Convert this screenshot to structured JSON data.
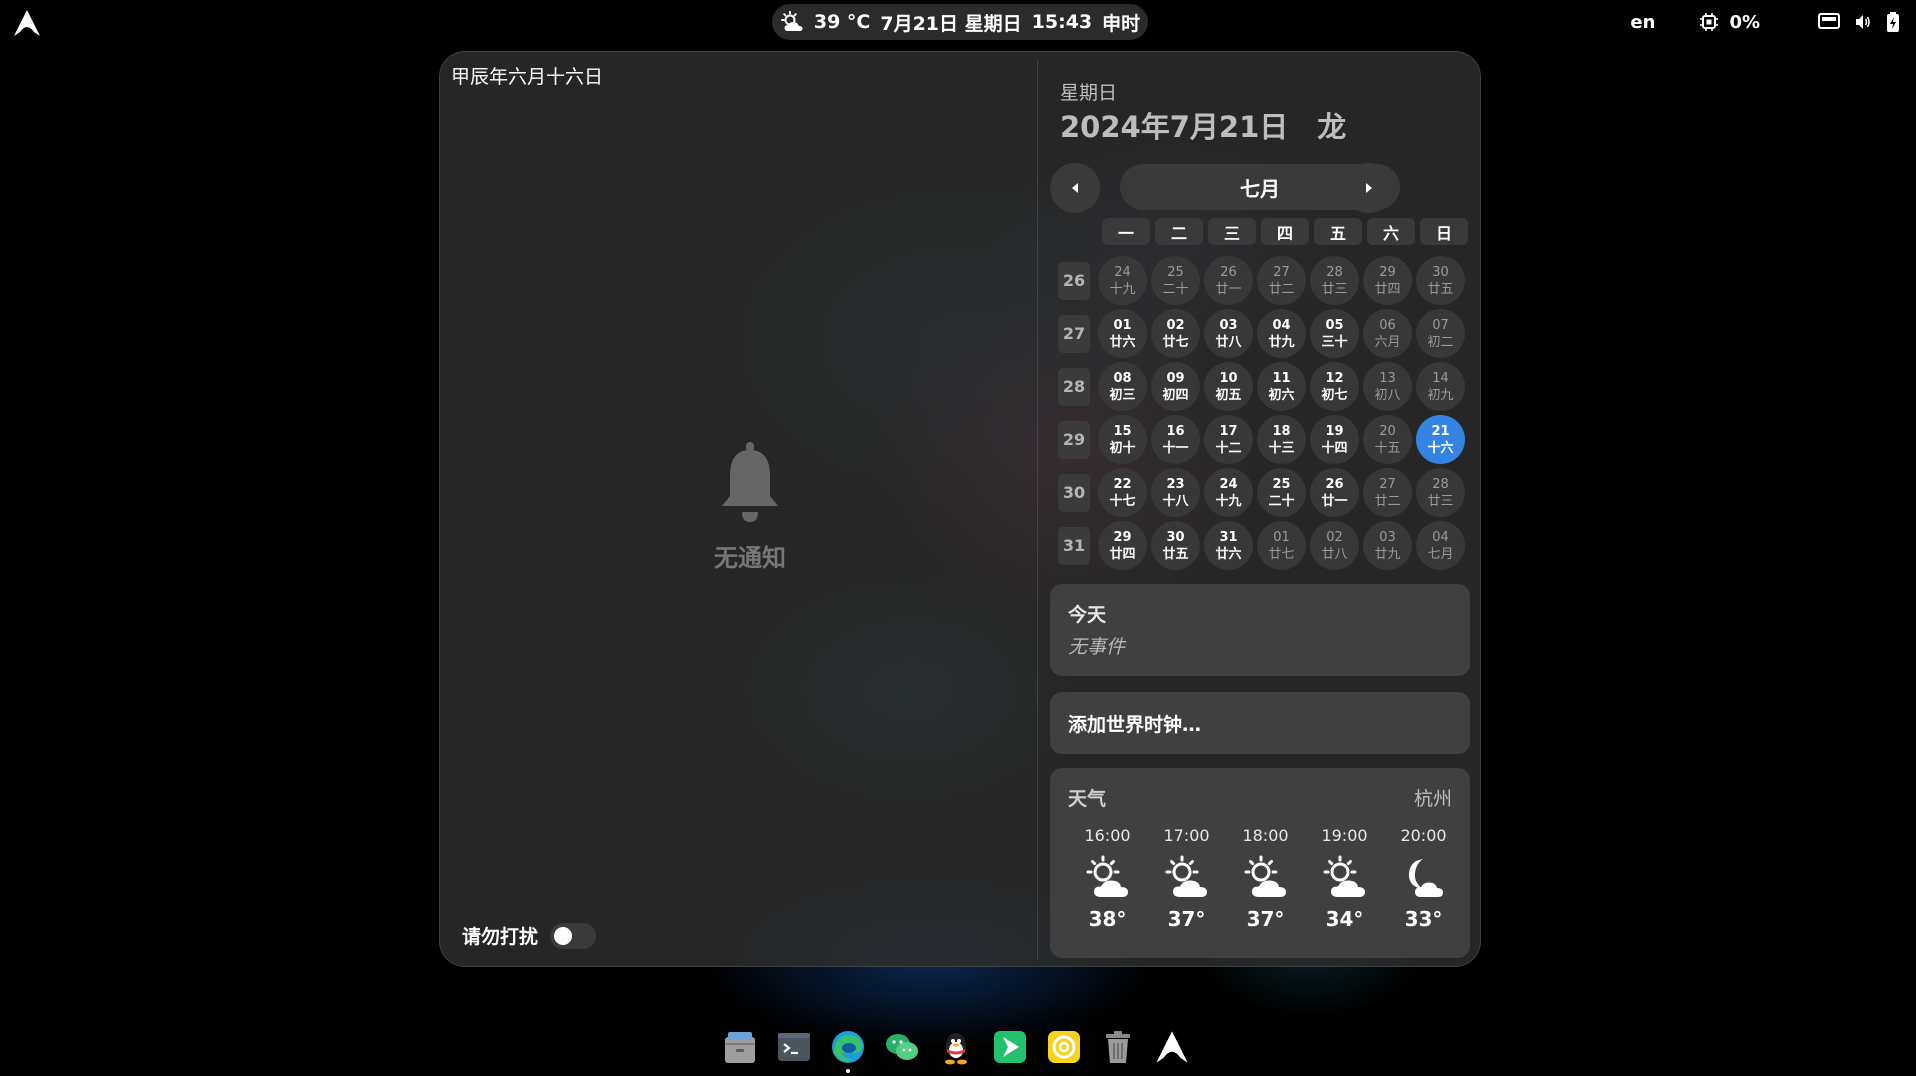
{
  "topbar": {
    "activities_icon": "arch-linux-logo-icon",
    "weather_icon": "partly-cloudy-day-icon",
    "temperature": "39 °C",
    "date": "7月21日 星期日",
    "time": "15:43",
    "shichen": "申时",
    "keyboard_layout": "en",
    "cpu_icon": "cpu-icon",
    "cpu_usage": "0%",
    "network_icon": "network-wired-icon",
    "volume_icon": "speaker-icon",
    "battery_icon": "battery-charging-icon"
  },
  "notifications": {
    "lunar_date_heading": "甲辰年六月十六日",
    "empty_icon": "bell-icon",
    "empty_label": "无通知",
    "dnd_label": "请勿打扰",
    "dnd_enabled": false
  },
  "calendar": {
    "weekday": "星期日",
    "full_date": "2024年7月21日　龙",
    "month_label": "七月",
    "prev_icon": "chevron-left-icon",
    "next_icon": "chevron-right-icon",
    "weekday_headers": [
      "一",
      "二",
      "三",
      "四",
      "五",
      "六",
      "日"
    ],
    "weeks": [
      {
        "week": "26",
        "days": [
          {
            "d": "24",
            "l": "十九",
            "other": true
          },
          {
            "d": "25",
            "l": "二十",
            "other": true
          },
          {
            "d": "26",
            "l": "廿一",
            "other": true
          },
          {
            "d": "27",
            "l": "廿二",
            "other": true
          },
          {
            "d": "28",
            "l": "廿三",
            "other": true
          },
          {
            "d": "29",
            "l": "廿四",
            "other": true
          },
          {
            "d": "30",
            "l": "廿五",
            "other": true
          }
        ]
      },
      {
        "week": "27",
        "days": [
          {
            "d": "01",
            "l": "廿六"
          },
          {
            "d": "02",
            "l": "廿七"
          },
          {
            "d": "03",
            "l": "廿八"
          },
          {
            "d": "04",
            "l": "廿九"
          },
          {
            "d": "05",
            "l": "三十"
          },
          {
            "d": "06",
            "l": "六月",
            "other": true
          },
          {
            "d": "07",
            "l": "初二",
            "other": true
          }
        ]
      },
      {
        "week": "28",
        "days": [
          {
            "d": "08",
            "l": "初三"
          },
          {
            "d": "09",
            "l": "初四"
          },
          {
            "d": "10",
            "l": "初五"
          },
          {
            "d": "11",
            "l": "初六"
          },
          {
            "d": "12",
            "l": "初七"
          },
          {
            "d": "13",
            "l": "初八",
            "other": true
          },
          {
            "d": "14",
            "l": "初九",
            "other": true
          }
        ]
      },
      {
        "week": "29",
        "days": [
          {
            "d": "15",
            "l": "初十"
          },
          {
            "d": "16",
            "l": "十一"
          },
          {
            "d": "17",
            "l": "十二"
          },
          {
            "d": "18",
            "l": "十三"
          },
          {
            "d": "19",
            "l": "十四"
          },
          {
            "d": "20",
            "l": "十五",
            "other": true
          },
          {
            "d": "21",
            "l": "十六",
            "today": true
          }
        ]
      },
      {
        "week": "30",
        "days": [
          {
            "d": "22",
            "l": "十七"
          },
          {
            "d": "23",
            "l": "十八"
          },
          {
            "d": "24",
            "l": "十九"
          },
          {
            "d": "25",
            "l": "二十"
          },
          {
            "d": "26",
            "l": "廿一"
          },
          {
            "d": "27",
            "l": "廿二",
            "other": true
          },
          {
            "d": "28",
            "l": "廿三",
            "other": true
          }
        ]
      },
      {
        "week": "31",
        "days": [
          {
            "d": "29",
            "l": "廿四"
          },
          {
            "d": "30",
            "l": "廿五"
          },
          {
            "d": "31",
            "l": "廿六"
          },
          {
            "d": "01",
            "l": "廿七",
            "other": true
          },
          {
            "d": "02",
            "l": "廿八",
            "other": true
          },
          {
            "d": "03",
            "l": "廿九",
            "other": true
          },
          {
            "d": "04",
            "l": "七月",
            "other": true
          }
        ]
      }
    ]
  },
  "events": {
    "title": "今天",
    "empty_text": "无事件"
  },
  "world_clocks": {
    "add_label": "添加世界时钟…"
  },
  "weather": {
    "title": "天气",
    "city": "杭州",
    "forecast": [
      {
        "time": "16:00",
        "icon": "partly-cloudy-day-icon",
        "temp": "38°"
      },
      {
        "time": "17:00",
        "icon": "partly-cloudy-day-icon",
        "temp": "37°"
      },
      {
        "time": "18:00",
        "icon": "partly-cloudy-day-icon",
        "temp": "37°"
      },
      {
        "time": "19:00",
        "icon": "partly-cloudy-day-icon",
        "temp": "34°"
      },
      {
        "time": "20:00",
        "icon": "night-cloudy-icon",
        "temp": "33°"
      }
    ]
  },
  "dock": {
    "items": [
      {
        "name": "files",
        "icon": "file-cabinet-icon",
        "color": "#c9c9c9",
        "running": false
      },
      {
        "name": "terminal",
        "icon": "terminal-icon",
        "color": "#4a5560",
        "running": false
      },
      {
        "name": "edge",
        "icon": "edge-browser-icon",
        "color": "#1f9be0",
        "running": true
      },
      {
        "name": "wechat",
        "icon": "wechat-icon",
        "color": "#2aae67",
        "running": false
      },
      {
        "name": "qq",
        "icon": "qq-penguin-icon",
        "color": "#222222",
        "running": false
      },
      {
        "name": "app-store",
        "icon": "play-store-icon",
        "color": "#23c06d",
        "running": false
      },
      {
        "name": "netease-music",
        "icon": "music-disc-icon",
        "color": "#f7d21f",
        "running": false
      },
      {
        "name": "trash",
        "icon": "trash-icon",
        "color": "#9a9a9a",
        "running": false
      },
      {
        "name": "arch",
        "icon": "arch-linux-logo-icon",
        "color": "#ffffff",
        "running": false
      }
    ]
  },
  "colors": {
    "accent": "#3584e4",
    "panel_bg": "#2c2c2c",
    "card_bg": "#404040"
  }
}
